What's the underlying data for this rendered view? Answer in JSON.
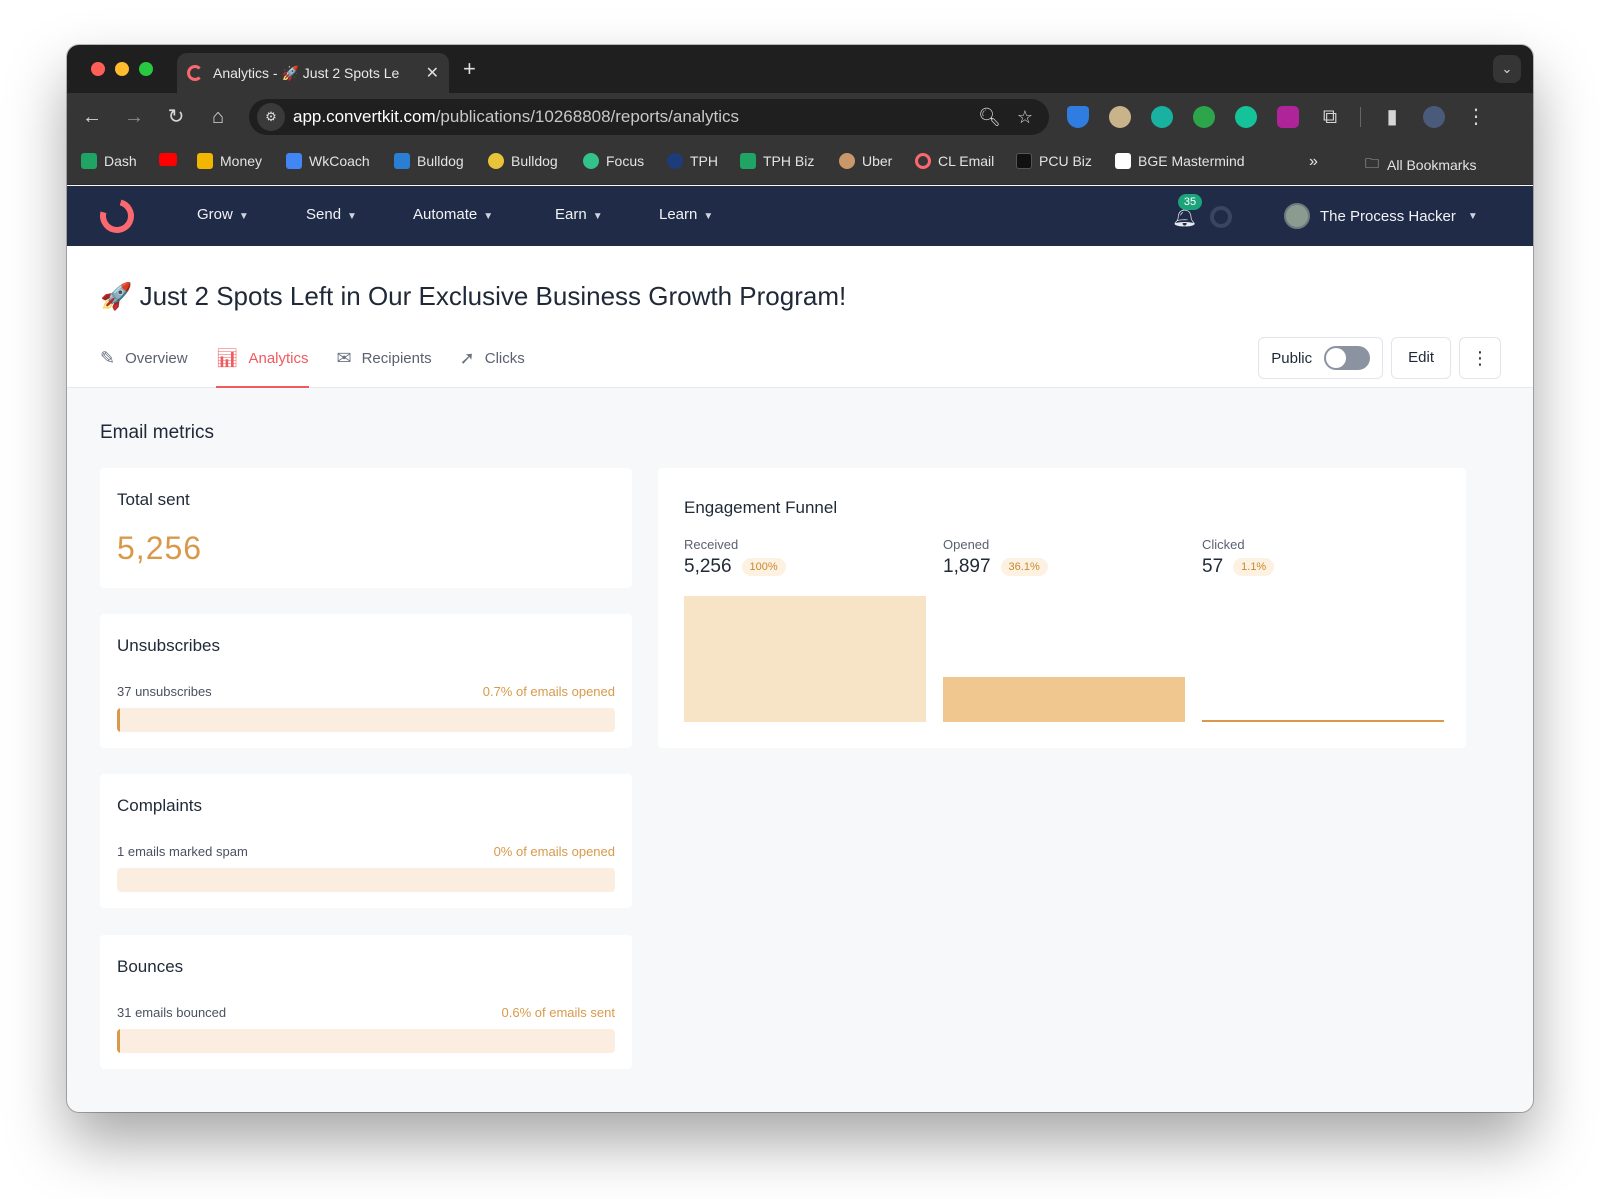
{
  "browser": {
    "tab_title": "Analytics - 🚀 Just 2 Spots Le",
    "url_host": "app.convertkit.com",
    "url_path": "/publications/10268808/reports/analytics",
    "bookmarks": [
      "Dash",
      "Money",
      "WkCoach",
      "Bulldog",
      "Bulldog",
      "Focus",
      "TPH",
      "TPH Biz",
      "Uber",
      "CL Email",
      "PCU Biz",
      "BGE Mastermind"
    ],
    "all_bookmarks": "All Bookmarks"
  },
  "app": {
    "nav": [
      "Grow",
      "Send",
      "Automate",
      "Earn",
      "Learn"
    ],
    "notification_count": "35",
    "user_name": "The Process Hacker"
  },
  "page": {
    "title": "🚀 Just 2 Spots Left in Our Exclusive Business Growth Program!",
    "tabs": [
      "Overview",
      "Analytics",
      "Recipients",
      "Clicks"
    ],
    "active_tab": "Analytics",
    "public_label": "Public",
    "public_enabled": false,
    "edit_label": "Edit"
  },
  "metrics": {
    "section_title": "Email metrics",
    "total_sent": {
      "title": "Total sent",
      "value": "5,256"
    },
    "unsubscribes": {
      "title": "Unsubscribes",
      "detail": "37 unsubscribes",
      "pct": "0.7% of emails opened",
      "fraction": 0.007
    },
    "complaints": {
      "title": "Complaints",
      "detail": "1 emails marked spam",
      "pct": "0% of emails opened",
      "fraction": 0
    },
    "bounces": {
      "title": "Bounces",
      "detail": "31 emails bounced",
      "pct": "0.6% of emails sent",
      "fraction": 0.006
    }
  },
  "funnel": {
    "title": "Engagement Funnel",
    "stages": [
      {
        "label": "Received",
        "value": "5,256",
        "pct": "100%",
        "fraction": 1.0,
        "color": "#f7e3c6"
      },
      {
        "label": "Opened",
        "value": "1,897",
        "pct": "36.1%",
        "fraction": 0.361,
        "color": "#f0c78e"
      },
      {
        "label": "Clicked",
        "value": "57",
        "pct": "1.1%",
        "fraction": 0.011,
        "color": "#d89a4a"
      }
    ]
  }
}
